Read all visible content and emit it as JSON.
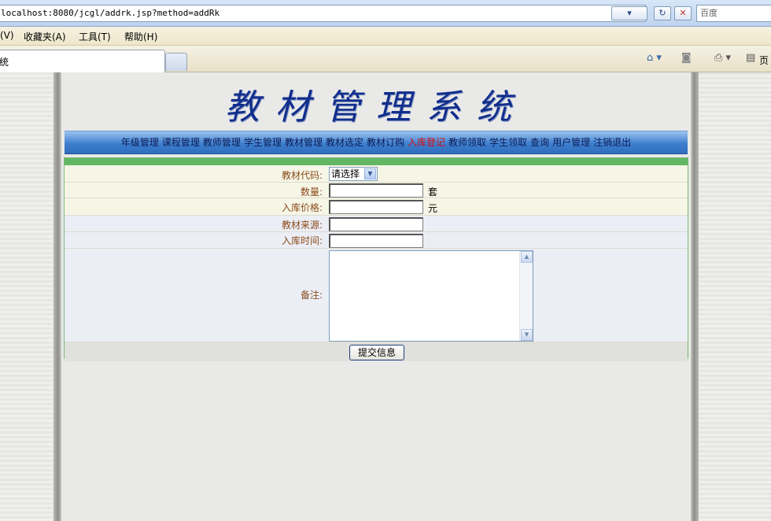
{
  "browser": {
    "url": "localhost:8080/jcgl/addrk.jsp?method=addRk",
    "search_placeholder": "百度",
    "menu": [
      "(V)",
      "收藏夹(A)",
      "工具(T)",
      "帮助(H)"
    ],
    "tab_title": "统",
    "page_menu_label": "页"
  },
  "site": {
    "title": "教材管理系统"
  },
  "nav": {
    "items": [
      "年级管理",
      "课程管理",
      "教师管理",
      "学生管理",
      "教材管理",
      "教材选定",
      "教材订购",
      "入库登记",
      "教师领取",
      "学生领取",
      "查询",
      "用户管理",
      "注销退出"
    ],
    "active": "入库登记"
  },
  "form": {
    "code_label": "教材代码:",
    "code_selected": "请选择",
    "quantity_label": "数量:",
    "quantity_unit": "套",
    "price_label": "入库价格:",
    "price_unit": "元",
    "source_label": "教材来源:",
    "time_label": "入库时间:",
    "remark_label": "备注:",
    "submit_label": "提交信息"
  },
  "colors": {
    "title": "#102e8c",
    "nav_active": "#d80d0d",
    "label": "#8a4a1a",
    "form_top_bar": "#63b763"
  }
}
